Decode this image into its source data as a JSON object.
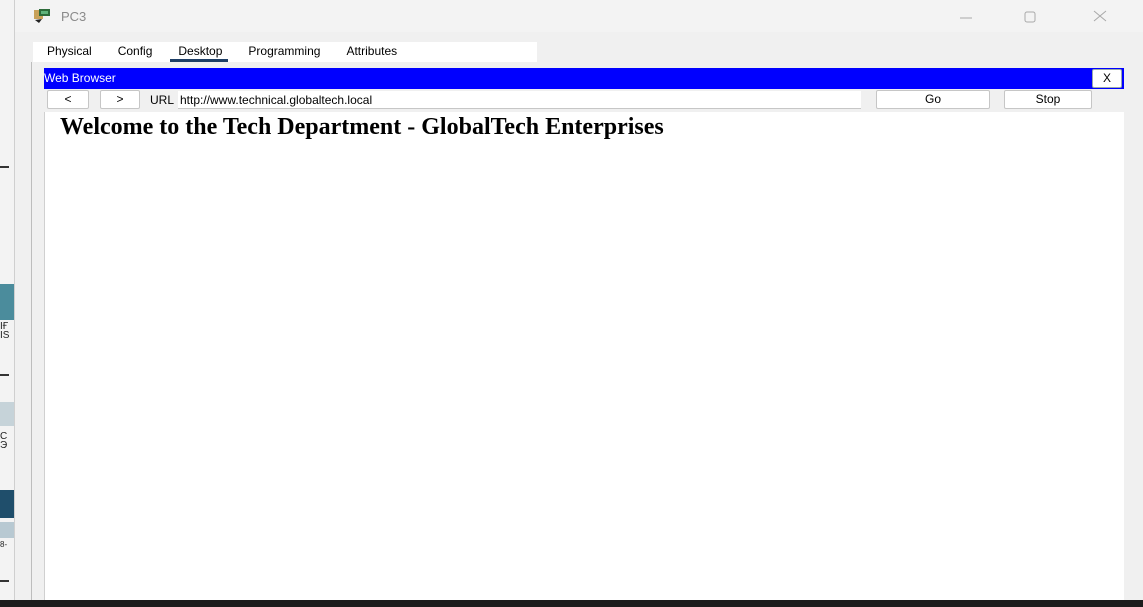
{
  "window": {
    "title": "PC3"
  },
  "tabs": [
    {
      "label": "Physical"
    },
    {
      "label": "Config"
    },
    {
      "label": "Desktop"
    },
    {
      "label": "Programming"
    },
    {
      "label": "Attributes"
    }
  ],
  "active_tab": "Desktop",
  "browser": {
    "title": "Web Browser",
    "close_label": "X",
    "back_label": "<",
    "forward_label": ">",
    "url_label": "URL",
    "url_value": "http://www.technical.globaltech.local",
    "go_label": "Go",
    "stop_label": "Stop"
  },
  "page": {
    "heading": "Welcome to the Tech Department - GlobalTech Enterprises"
  },
  "background": {
    "fragment_1": "ІҒ\nІS",
    "fragment_2": "С\nЭ",
    "fragment_3": "8-"
  },
  "colors": {
    "browser_titlebar": "#0000ff",
    "active_tab_underline": "#1e3f66",
    "bg_panel_teal": "#4b8c9c",
    "bg_panel_dark": "#1f4e6b"
  },
  "icons": {
    "app": "packet-tracer-pc-icon",
    "minimize": "minimize-icon",
    "maximize": "maximize-icon",
    "close": "close-icon"
  }
}
